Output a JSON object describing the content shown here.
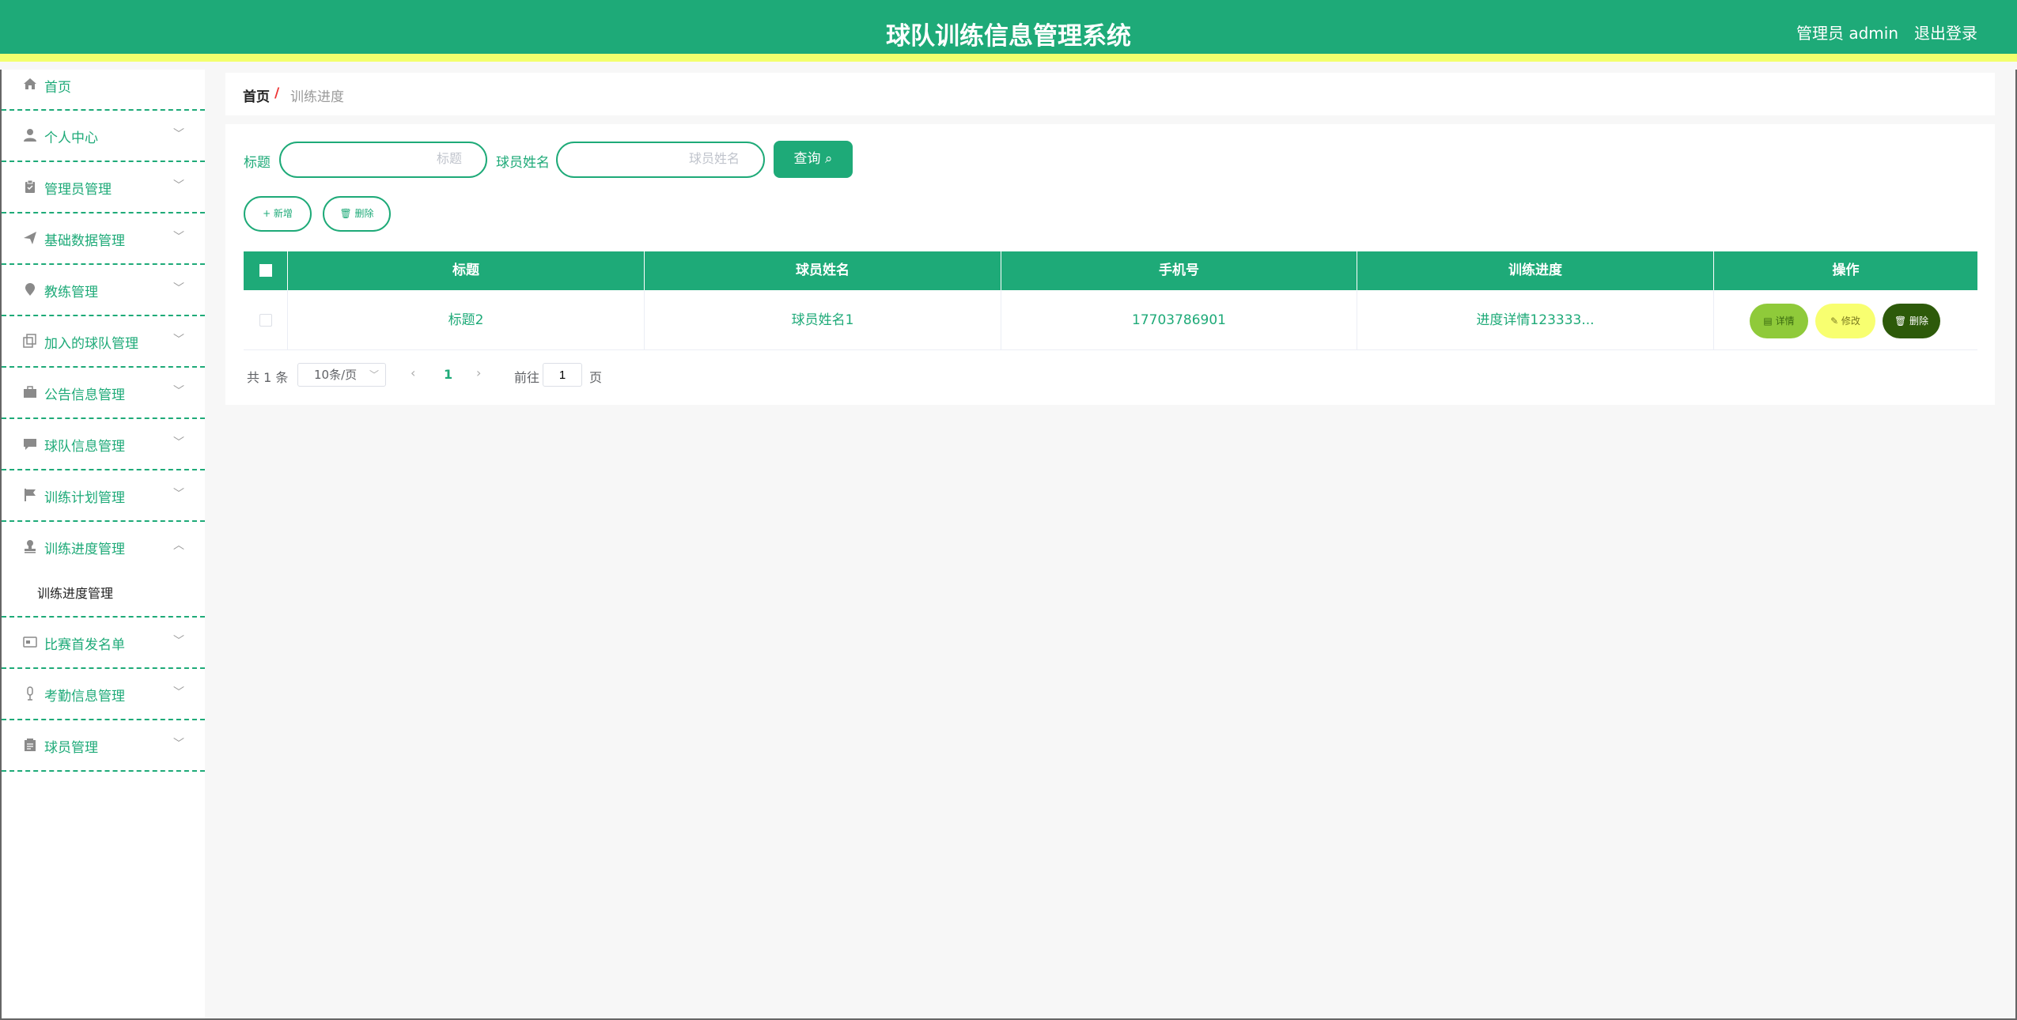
{
  "header": {
    "title": "球队训练信息管理系统",
    "user": "管理员 admin",
    "logout": "退出登录"
  },
  "sidebar": {
    "items": [
      {
        "label": "首页",
        "icon": "home-icon"
      },
      {
        "label": "个人中心",
        "icon": "user-icon"
      },
      {
        "label": "管理员管理",
        "icon": "clipboard-icon"
      },
      {
        "label": "基础数据管理",
        "icon": "send-icon"
      },
      {
        "label": "教练管理",
        "icon": "location-icon"
      },
      {
        "label": "加入的球队管理",
        "icon": "copy-icon"
      },
      {
        "label": "公告信息管理",
        "icon": "briefcase-icon"
      },
      {
        "label": "球队信息管理",
        "icon": "chat-icon"
      },
      {
        "label": "训练计划管理",
        "icon": "flag-icon"
      },
      {
        "label": "训练进度管理",
        "icon": "stamp-icon"
      },
      {
        "label": "比赛首发名单",
        "icon": "card-icon"
      },
      {
        "label": "考勤信息管理",
        "icon": "microphone-icon"
      },
      {
        "label": "球员管理",
        "icon": "notepad-icon"
      }
    ],
    "submenu": {
      "label": "训练进度管理"
    }
  },
  "breadcrumb": {
    "home": "首页",
    "separator": "/",
    "current": "训练进度"
  },
  "search": {
    "title_label": "标题",
    "title_placeholder": "标题",
    "player_label": "球员姓名",
    "player_placeholder": "球员姓名",
    "query_label": "查询 ⌕"
  },
  "actions": {
    "add_label": "+ 新增",
    "delete_label": "🗑 删除"
  },
  "table": {
    "columns": [
      "标题",
      "球员姓名",
      "手机号",
      "训练进度",
      "操作"
    ],
    "rows": [
      {
        "title": "标题2",
        "player_name": "球员姓名1",
        "phone": "17703786901",
        "progress": "进度详情123333...",
        "detail_label": "▤ 详情",
        "edit_label": "✎ 修改",
        "delete_label": "🗑 删除"
      }
    ]
  },
  "pagination": {
    "total": "共 1 条",
    "page_size": "10条/页",
    "current_page": "1",
    "goto_label": "前往",
    "goto_value": "1",
    "page_suffix": "页"
  },
  "colors": {
    "primary": "#1eaa78",
    "header_stripe": "#f3ff6e",
    "detail_button": "#8fca3a",
    "edit_button": "#f8ff70",
    "delete_button": "#2d5a0a",
    "breadcrumb_separator": "#ee3333"
  }
}
